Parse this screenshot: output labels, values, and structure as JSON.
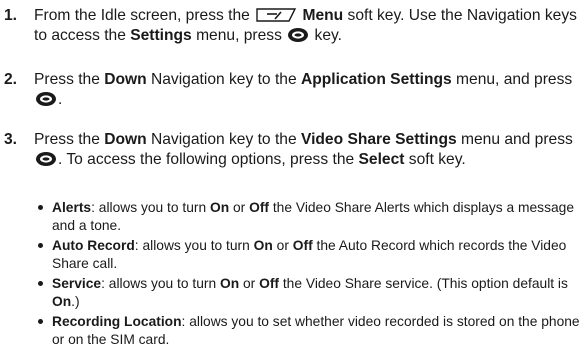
{
  "steps": [
    {
      "number": "1.",
      "parts": [
        "From the Idle screen, press the ",
        "Menu",
        " soft key. Use the Navigation keys to access the ",
        "Settings",
        " menu, press ",
        " key."
      ]
    },
    {
      "number": "2.",
      "parts": [
        "Press the ",
        "Down",
        " Navigation key to the ",
        "Application Settings",
        " menu, and press ",
        "."
      ]
    },
    {
      "number": "3.",
      "parts": [
        "Press the ",
        "Down",
        " Navigation key to the ",
        "Video Share Settings",
        " menu and press ",
        ". To access the following options, press the ",
        "Select",
        " soft key."
      ]
    }
  ],
  "bullets": [
    {
      "term": "Alerts",
      "parts": [
        ": allows you to turn ",
        "On",
        " or ",
        "Off",
        " the Video Share Alerts which displays a message and a tone."
      ]
    },
    {
      "term": "Auto Record",
      "parts": [
        ": allows you to turn ",
        "On",
        " or ",
        "Off",
        " the Auto Record which records the Video Share call."
      ]
    },
    {
      "term": "Service",
      "parts": [
        ": allows you to turn ",
        "On",
        " or ",
        "Off",
        " the Video Share service. (This option default is ",
        "On",
        ".)"
      ]
    },
    {
      "term": "Recording Location",
      "parts": [
        ": allows you to set whether video recorded is stored on the phone or on the SIM card."
      ]
    }
  ],
  "icons": {
    "softkey": "left-softkey-icon",
    "ok": "ok-key-icon"
  }
}
